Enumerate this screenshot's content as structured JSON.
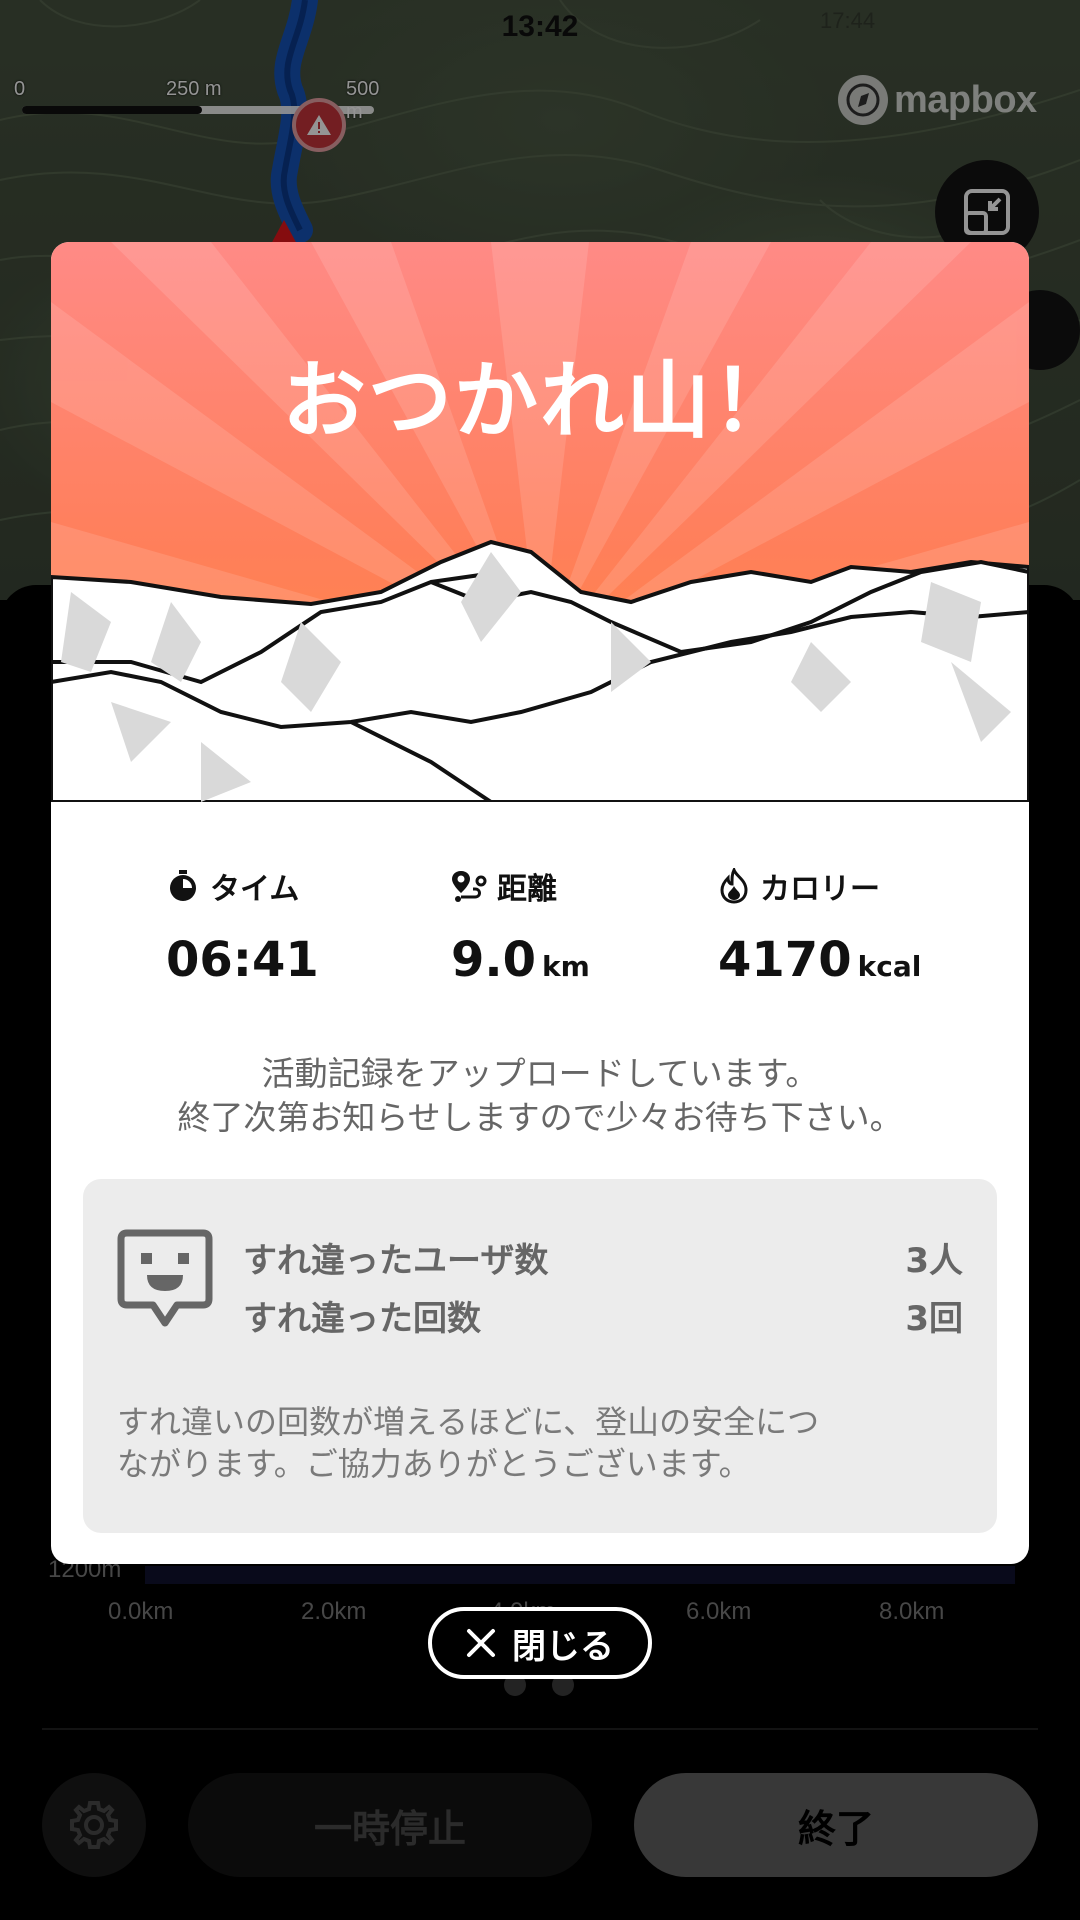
{
  "status_bar": {
    "time": "13:42",
    "ghost_time": "17:44"
  },
  "map": {
    "scale": {
      "labels": [
        "0",
        "250 m",
        "500 m"
      ]
    },
    "attribution": "mapbox",
    "icons": {
      "layout": "minimize-layout-icon",
      "warning": "warning-icon",
      "start": "start-flag-icon"
    }
  },
  "modal": {
    "title": "おつかれ山！",
    "stats": [
      {
        "label": "タイム",
        "icon": "stopwatch-icon",
        "value": "06:41",
        "unit": ""
      },
      {
        "label": "距離",
        "icon": "route-icon",
        "value": "9.0",
        "unit": "km"
      },
      {
        "label": "カロリー",
        "icon": "flame-icon",
        "value": "4170",
        "unit": "kcal"
      }
    ],
    "upload_message": {
      "line1": "活動記録をアップロードしています。",
      "line2": "終了次第お知らせしますので少々お待ち下さい。"
    },
    "encounter": {
      "icon": "face-speech-icon",
      "rows": [
        {
          "label": "すれ違ったユーザ数",
          "value": "3人"
        },
        {
          "label": "すれ違った回数",
          "value": "3回"
        }
      ],
      "note_line1": "すれ違いの回数が増えるほどに、登山の安全につ",
      "note_line2": "ながります。ご協力ありがとうございます。"
    }
  },
  "close_button": {
    "label": "閉じる",
    "icon": "close-icon"
  },
  "elevation_graph": {
    "y_label": "1200m",
    "x_labels": [
      "0.0km",
      "2.0km",
      "4.0km",
      "6.0km",
      "8.0km"
    ]
  },
  "controls": {
    "settings_icon": "gear-icon",
    "pause_label": "一時停止",
    "end_label": "終了"
  },
  "colors": {
    "hero_top": "#ff8a86",
    "hero_bottom": "#ff8a3a",
    "accent_text": "#111111",
    "muted_text": "#666666"
  }
}
